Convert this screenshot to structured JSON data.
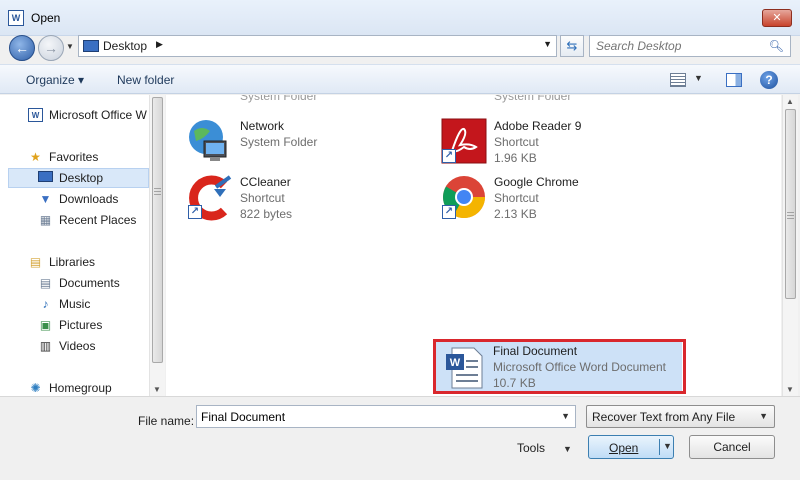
{
  "window": {
    "title": "Open",
    "app_icon_letter": "W",
    "close_glyph": "✕"
  },
  "nav": {
    "back_glyph": "←",
    "forward_glyph": "→"
  },
  "address": {
    "crumb": "Desktop"
  },
  "search": {
    "placeholder": "Search Desktop"
  },
  "toolbar": {
    "organize": "Organize ▾",
    "new_folder": "New folder",
    "help": "?"
  },
  "sidebar": {
    "items": [
      {
        "label": "System Folder",
        "icon": "folder-icon"
      },
      {
        "label": "Microsoft Office W",
        "icon": "word-icon"
      },
      {
        "label": "Favorites",
        "icon": "star-icon"
      },
      {
        "label": "Desktop",
        "icon": "desktop-icon"
      },
      {
        "label": "Downloads",
        "icon": "downloads-icon"
      },
      {
        "label": "Recent Places",
        "icon": "recent-places-icon"
      },
      {
        "label": "Libraries",
        "icon": "libraries-icon"
      },
      {
        "label": "Documents",
        "icon": "documents-icon"
      },
      {
        "label": "Music",
        "icon": "music-icon"
      },
      {
        "label": "Pictures",
        "icon": "pictures-icon"
      },
      {
        "label": "Videos",
        "icon": "videos-icon"
      },
      {
        "label": "Homegroup",
        "icon": "homegroup-icon"
      }
    ]
  },
  "files": [
    {
      "name": "Network",
      "type": "System Folder",
      "size": "",
      "icon": "network-icon",
      "shortcut": false
    },
    {
      "name": "Adobe Reader 9",
      "type": "Shortcut",
      "size": "1.96 KB",
      "icon": "adobe-reader-icon",
      "shortcut": true
    },
    {
      "name": "CCleaner",
      "type": "Shortcut",
      "size": "822 bytes",
      "icon": "ccleaner-icon",
      "shortcut": true
    },
    {
      "name": "Google Chrome",
      "type": "Shortcut",
      "size": "2.13 KB",
      "icon": "chrome-icon",
      "shortcut": true
    },
    {
      "name": "Final Document",
      "type": "Microsoft Office Word Document",
      "size": "10.7 KB",
      "icon": "word-document-icon",
      "shortcut": false
    }
  ],
  "partial_top": {
    "left": "System Folder",
    "right": "System Folder"
  },
  "bottom": {
    "filename_label": "File name:",
    "filename_value": "Final Document",
    "filetype": "Recover Text from Any File",
    "tools": "Tools",
    "open": "Open",
    "cancel": "Cancel"
  },
  "colors": {
    "highlight": "#d9272d",
    "accent": "#2f5fa8"
  }
}
